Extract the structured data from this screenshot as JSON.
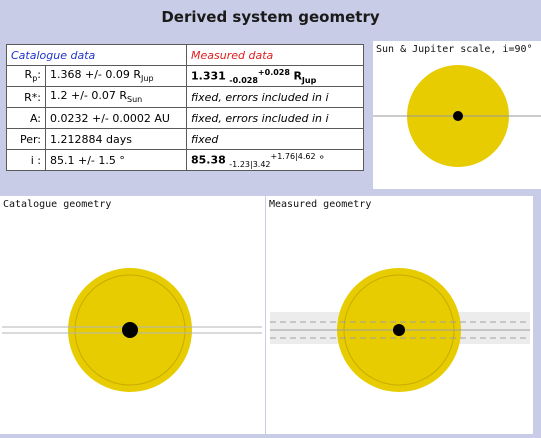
{
  "title": "Derived system geometry",
  "table": {
    "header_catalogue": "Catalogue data",
    "header_measured": "Measured data",
    "rows": [
      {
        "key": "R",
        "key_sub": "p",
        "key_tail": ":",
        "cat_main": "1.368 +/- 0.09 R",
        "cat_sub": "Jup",
        "measured_bold": "1.331",
        "measured_lower": "-0.028",
        "measured_upper": "+0.028",
        "measured_unit": "R",
        "measured_unit_sub": "Jup"
      },
      {
        "key": "R*:",
        "cat_main": "1.2 +/- 0.07 R",
        "cat_sub": "Sun",
        "measured_text": "fixed, errors included in i"
      },
      {
        "key": "A:",
        "cat_main": "0.0232 +/- 0.0002 AU",
        "measured_text": "fixed, errors included in i"
      },
      {
        "key": "Per:",
        "cat_main": "1.212884 days",
        "measured_text": "fixed"
      },
      {
        "key": "i :",
        "cat_main": "85.1 +/- 1.5 °",
        "measured_bold": "85.38",
        "measured_lower": "-1.23|3.42",
        "measured_upper": "+1.76|4.62",
        "measured_unit": "°"
      }
    ]
  },
  "panels": {
    "scale_title": "Sun & Jupiter scale, i=90°",
    "catalogue_title": "Catalogue geometry",
    "measured_title": "Measured geometry"
  },
  "colors": {
    "star": "#e6cc00",
    "star_ring": "#c8ac00",
    "planet": "#000000",
    "background": "#c9cce6",
    "orbit_line": "#9a9a9a"
  }
}
